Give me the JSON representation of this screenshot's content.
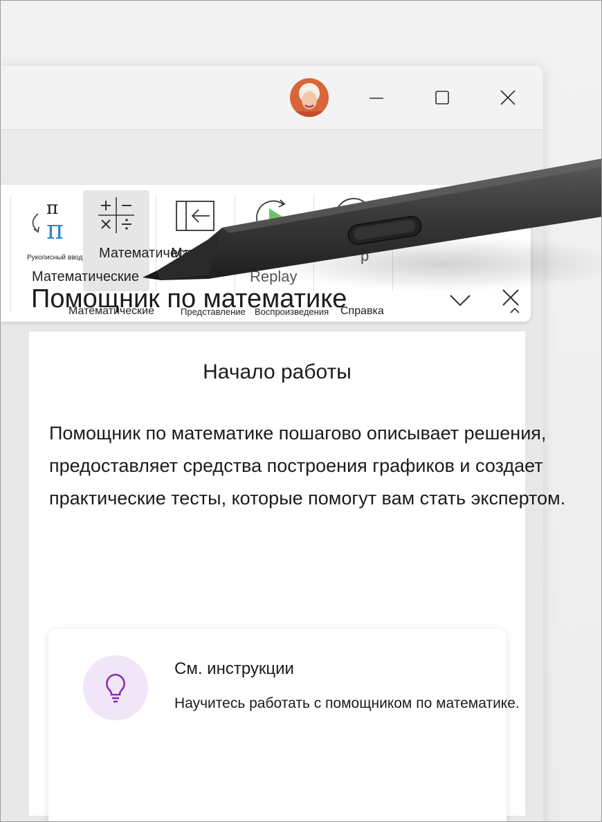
{
  "window": {
    "controls": {
      "minimize": "minimize",
      "maximize": "maximize",
      "close": "close"
    }
  },
  "ribbon": {
    "ink_math_label": "Рукописный ввод в",
    "math_button_label": "Математические",
    "math_tooltip": "Математические",
    "view_button_label": "Математические",
    "replay_label": "Replay",
    "help_label": "p",
    "groups": {
      "math": "Математические",
      "view": "Представление",
      "replay": "Воспроизведения",
      "help": "Справка"
    }
  },
  "panel": {
    "title": "Помощник по математике",
    "start_title": "Начало работы",
    "description": "Помощник по математике пошагово описывает решения, предоставляет средства построения графиков и создает практические тесты, которые помогут вам стать экспертом.",
    "hint": {
      "title": "См. инструкции",
      "subtitle": "Научитесь работать с помощником по математике."
    }
  },
  "colors": {
    "accent_teal": "#2b88d8",
    "replay_green": "#6ec36a",
    "bulb_purple": "#8a2db5",
    "bulb_bg": "#f1e6f8"
  },
  "icons": [
    "pi-ink-icon",
    "math-symbols-icon",
    "view-panel-icon",
    "replay-icon",
    "help-icon",
    "chevron-up-icon",
    "chevron-down-icon",
    "close-icon",
    "lightbulb-icon"
  ]
}
